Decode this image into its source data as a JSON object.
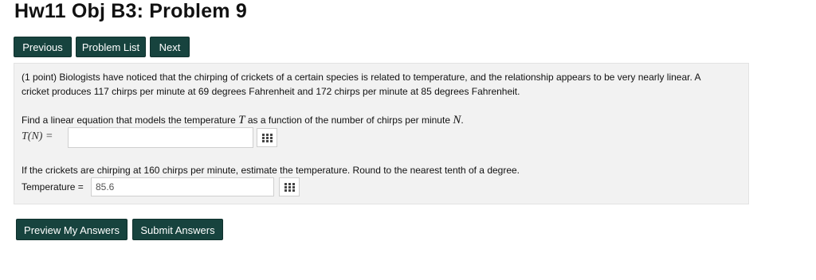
{
  "page_title": "Hw11 Obj B3: Problem 9",
  "nav": {
    "previous": "Previous",
    "problem_list": "Problem List",
    "next": "Next"
  },
  "problem": {
    "line1": "(1 point) Biologists have noticed that the chirping of crickets of a certain species is related to temperature, and the relationship appears to be very nearly linear. A",
    "line2": "cricket produces 117 chirps per minute at 69 degrees Fahrenheit and 172 chirps per minute at 85 degrees Fahrenheit.",
    "q1_before": "Find a linear equation that models the temperature ",
    "q1_var_T": "T",
    "q1_middle": " as a function of the number of chirps per minute ",
    "q1_var_N": "N",
    "q1_end": ".",
    "q1_label": "T(N) =",
    "q1_value": "",
    "q2": "If the crickets are chirping at 160 chirps per minute, estimate the temperature. Round to the nearest tenth of a degree.",
    "q2_label": "Temperature =",
    "q2_value": "85.6"
  },
  "footer": {
    "preview": "Preview My Answers",
    "submit": "Submit Answers"
  },
  "icons": {
    "palette": "equation-palette-icon"
  },
  "colors": {
    "button_bg": "#17433e",
    "box_bg": "#f2f2f2"
  }
}
